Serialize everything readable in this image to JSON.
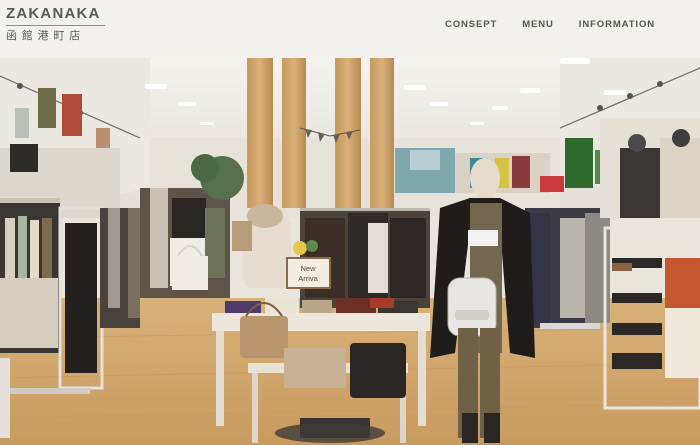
{
  "brand": {
    "name": "ZAKANAKA",
    "subtitle": "函館港町店"
  },
  "nav": {
    "items": [
      {
        "label": "CONSEPT"
      },
      {
        "label": "MENU"
      },
      {
        "label": "INFORMATION"
      }
    ]
  },
  "hero": {
    "sign_line1": "New",
    "sign_line2": "Arriva"
  }
}
